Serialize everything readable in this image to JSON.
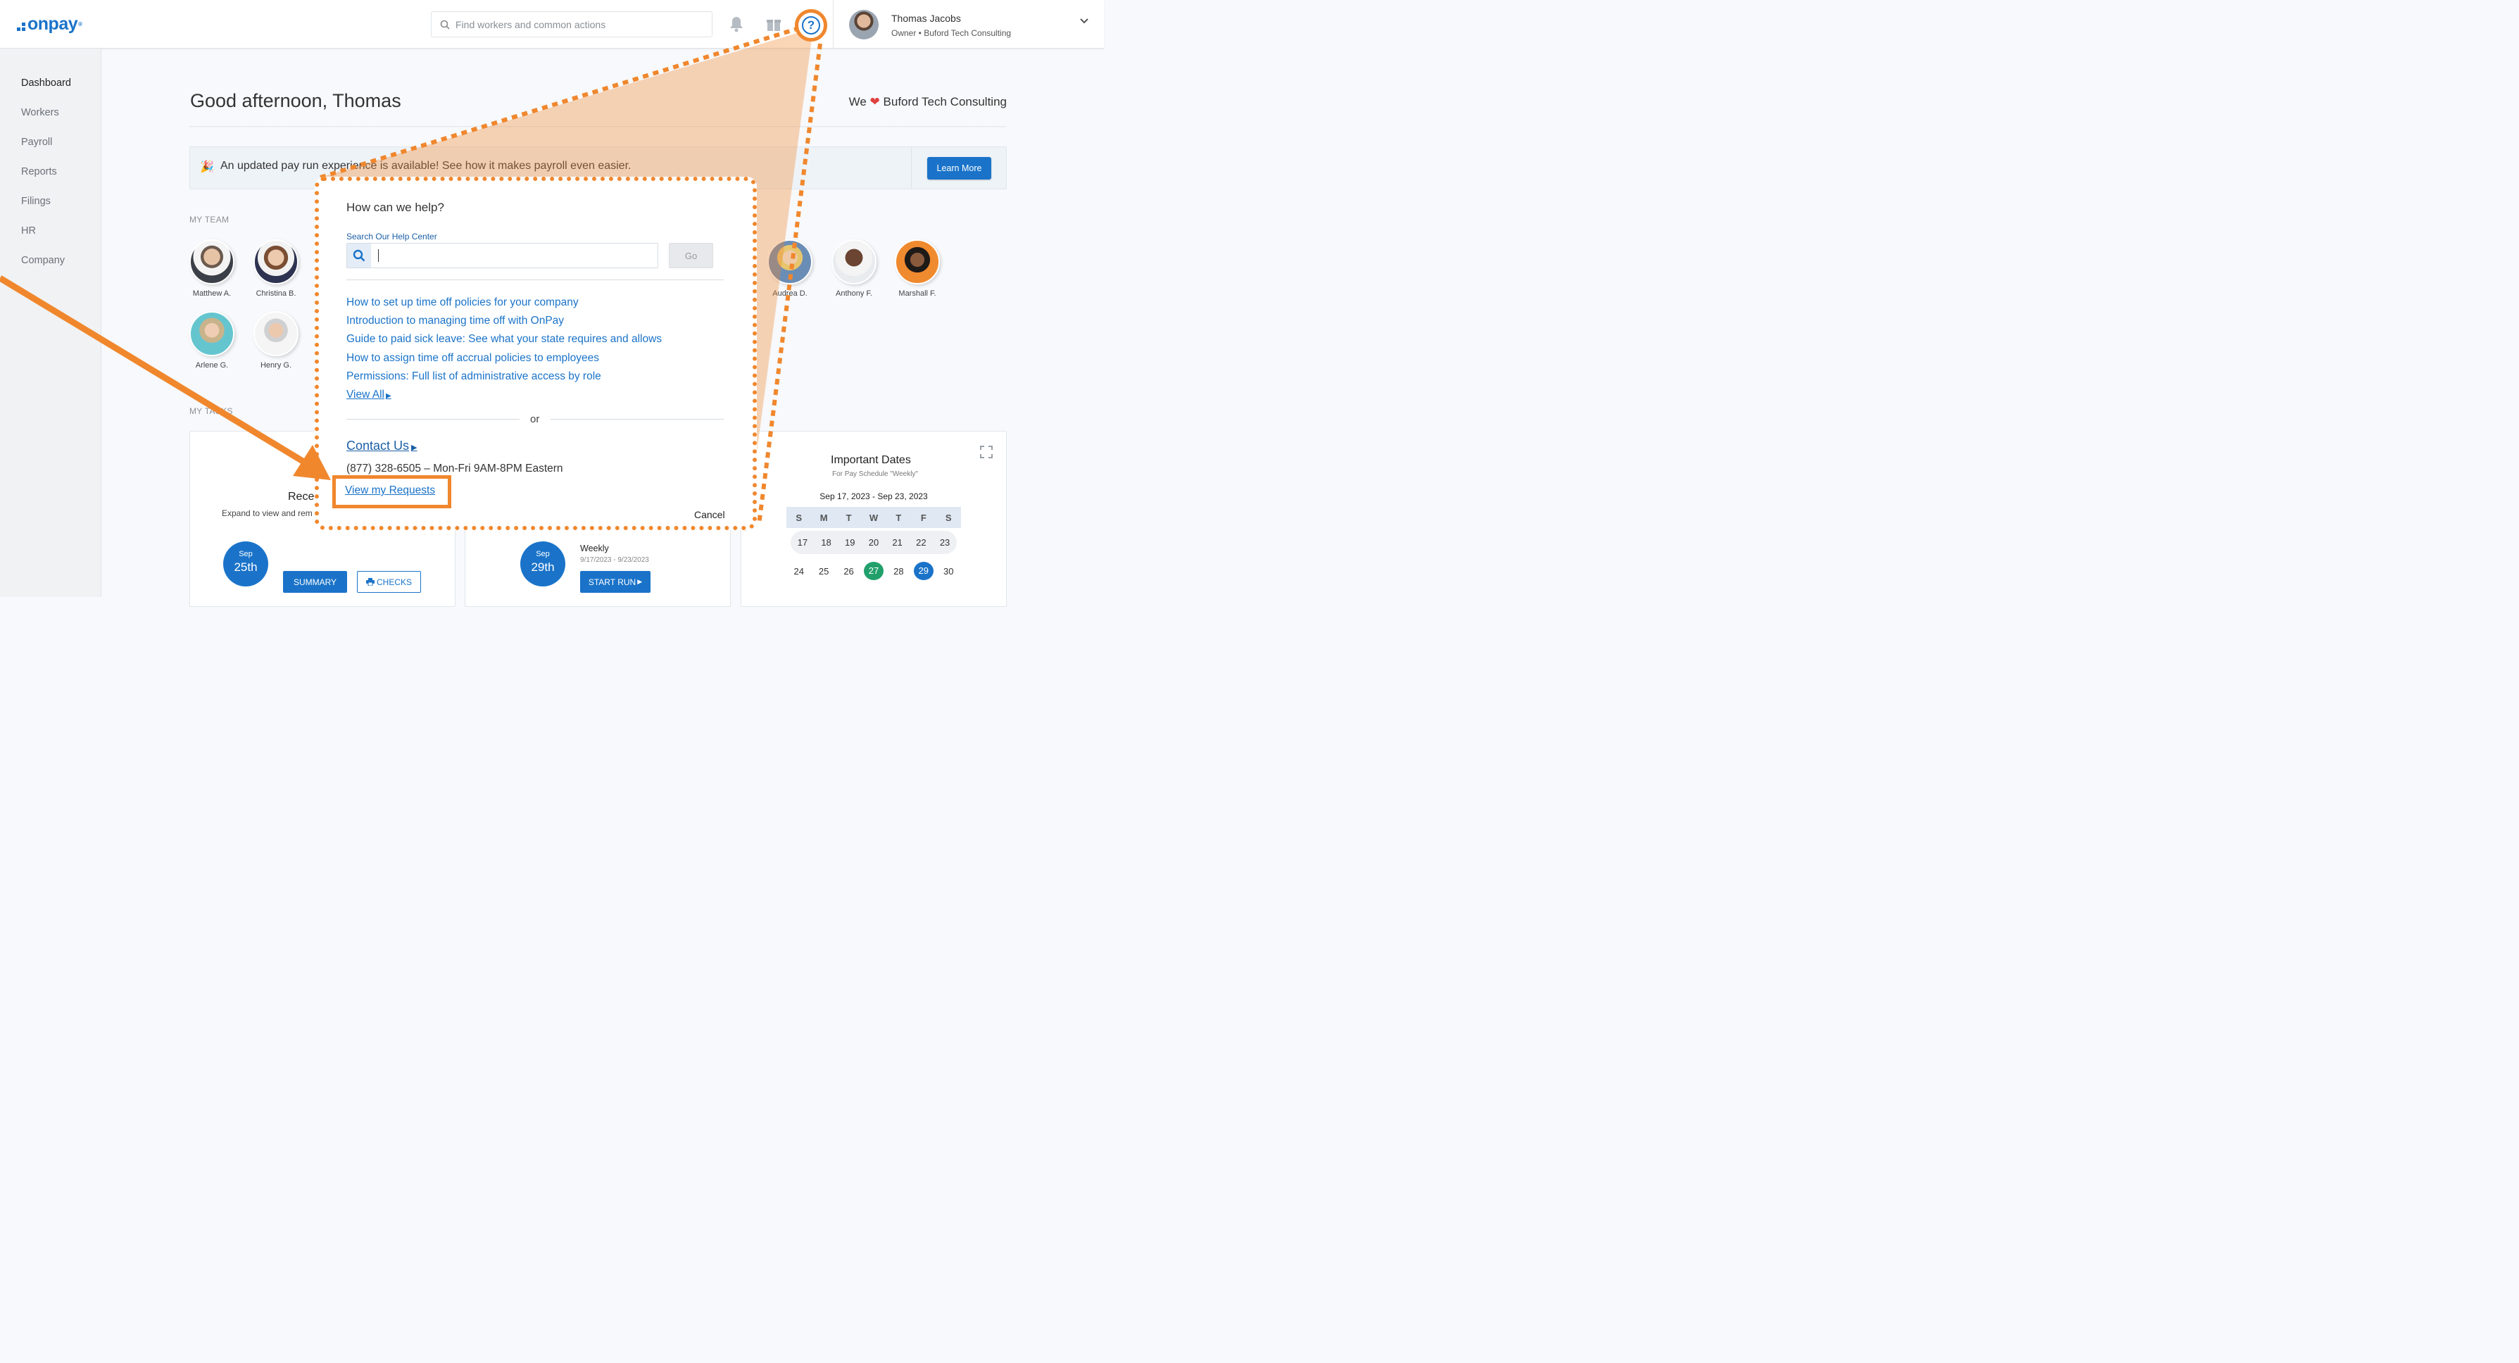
{
  "header": {
    "logo_text": "onpay",
    "logo_mark": "®",
    "search_placeholder": "Find workers and common actions",
    "user_name": "Thomas Jacobs",
    "user_role": "Owner • Buford Tech Consulting"
  },
  "sidebar": {
    "items": [
      {
        "label": "Dashboard"
      },
      {
        "label": "Workers"
      },
      {
        "label": "Payroll"
      },
      {
        "label": "Reports"
      },
      {
        "label": "Filings"
      },
      {
        "label": "HR"
      },
      {
        "label": "Company"
      }
    ]
  },
  "main": {
    "greeting": "Good afternoon, Thomas",
    "love_prefix": "We",
    "love_company": "Buford Tech Consulting",
    "banner_emoji": "🎉",
    "banner_text": "An updated pay run experience is available! See how it makes payroll even easier.",
    "learn_more": "Learn More",
    "my_team_label": "MY TEAM",
    "my_tasks_label": "MY TASKS",
    "team": [
      {
        "name": "Matthew A."
      },
      {
        "name": "Christina B."
      },
      {
        "name": "Audrea D."
      },
      {
        "name": "Anthony F."
      },
      {
        "name": "Marshall F."
      },
      {
        "name": "Arlene G."
      },
      {
        "name": "Henry G."
      }
    ]
  },
  "cards": {
    "recent_title": "Rece",
    "recent_sub": "Expand to view and rem",
    "recent_month": "Sep",
    "recent_day": "25th",
    "summary": "SUMMARY",
    "checks": "CHECKS",
    "upcoming_month": "Sep",
    "upcoming_day": "29th",
    "upcoming_title": "Weekly",
    "upcoming_range": "9/17/2023 - 9/23/2023",
    "start_run": "START RUN",
    "important_title": "Important Dates",
    "important_sub": "For Pay Schedule \"Weekly\"",
    "cal_range": "Sep 17, 2023 - Sep 23, 2023",
    "cal_days": [
      "S",
      "M",
      "T",
      "W",
      "T",
      "F",
      "S"
    ],
    "cal_week1": [
      "17",
      "18",
      "19",
      "20",
      "21",
      "22",
      "23"
    ],
    "cal_week2": [
      "24",
      "25",
      "26",
      "27",
      "28",
      "29",
      "30"
    ]
  },
  "popup": {
    "title": "How can we help?",
    "search_label": "Search Our Help Center",
    "go": "Go",
    "links": [
      "How to set up time off policies for your company",
      "Introduction to managing time off with OnPay",
      "Guide to paid sick leave: See what your state requires and allows",
      "How to assign time off accrual policies to employees",
      "Permissions: Full list of administrative access by role"
    ],
    "view_all": "View All",
    "or": "or",
    "contact": "Contact Us",
    "phone": "(877) 328-6505 – Mon-Fri 9AM-8PM Eastern",
    "view_requests": "View my Requests",
    "cancel": "Cancel"
  },
  "colors": {
    "accent": "#1a73c9",
    "highlight": "#f0872d",
    "green": "#22a06b"
  }
}
